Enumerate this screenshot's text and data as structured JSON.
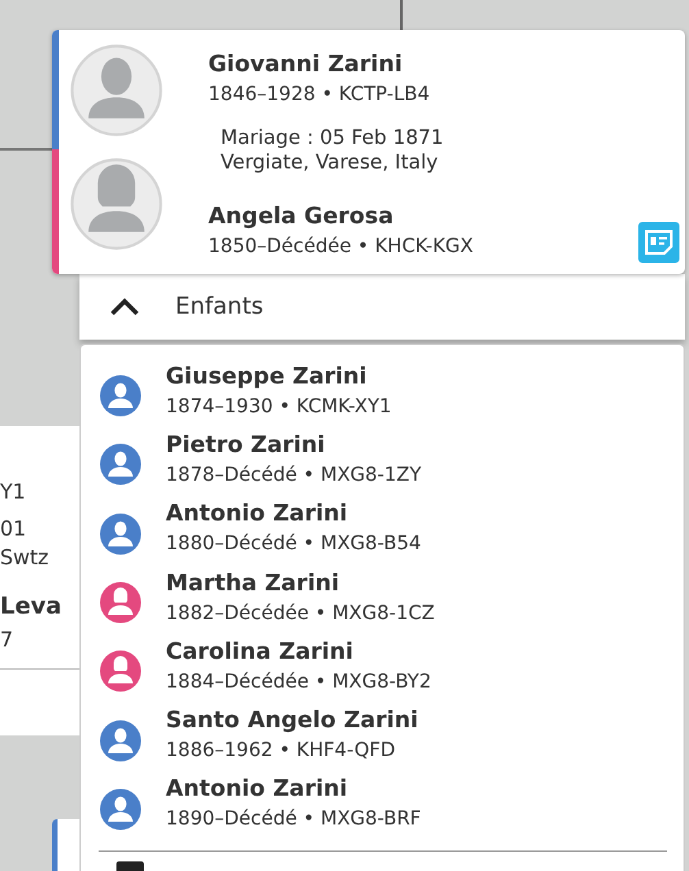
{
  "couple": {
    "father": {
      "name": "Giovanni Zarini",
      "details": "1846–1928 • KCTP-LB4",
      "kind": "male",
      "color": "#4a7fc9"
    },
    "marriage": {
      "date": "Mariage : 05 Feb 1871",
      "place": "Vergiate, Varese, Italy"
    },
    "mother": {
      "name": "Angela Gerosa",
      "details": "1850–Décédée • KHCK-KGX",
      "kind": "female",
      "color": "#e4497f"
    }
  },
  "children_toggle": {
    "label": "Enfants",
    "expanded": true
  },
  "children": [
    {
      "name": "Giuseppe Zarini",
      "details": "1874–1930 • KCMK-XY1",
      "kind": "male",
      "color": "#4a7fc9"
    },
    {
      "name": "Pietro Zarini",
      "details": "1878–Décédé • MXG8-1ZY",
      "kind": "male",
      "color": "#4a7fc9"
    },
    {
      "name": "Antonio Zarini",
      "details": "1880–Décédé • MXG8-B54",
      "kind": "male",
      "color": "#4a7fc9"
    },
    {
      "name": "Martha Zarini",
      "details": "1882–Décédée • MXG8-1CZ",
      "kind": "female",
      "color": "#e4497f"
    },
    {
      "name": "Carolina Zarini",
      "details": "1884–Décédée • MXG8-BY2",
      "kind": "female",
      "color": "#e4497f"
    },
    {
      "name": "Santo Angelo Zarini",
      "details": "1886–1962 • KHF4-QFD",
      "kind": "male",
      "color": "#4a7fc9"
    },
    {
      "name": "Antonio Zarini",
      "details": "1890–Décédé • MXG8-BRF",
      "kind": "male",
      "color": "#4a7fc9"
    }
  ],
  "background_card": {
    "lines": [
      "Y1",
      "01",
      "Swtz",
      "Leva",
      "7"
    ]
  }
}
